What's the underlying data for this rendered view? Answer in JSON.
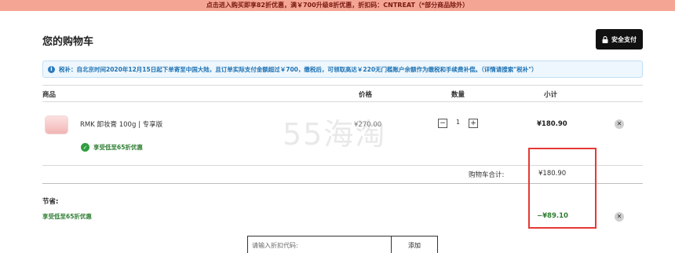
{
  "promo_banner": "点击进入购买即享82折优惠，满￥700升级8折优惠，折扣码：CNTREAT（*部分商品除外）",
  "page_title": "您的购物车",
  "checkout_button": "安全支付",
  "tax_notice": "税补：自北京时间2020年12月15日起下单寄至中国大陆，且订单实际支付金额超过￥700，缴税后，可领取高达￥220无门槛账户余额作为缴税和手续费补偿。（详情请搜索\"税补\"）",
  "table_headers": {
    "product": "商品",
    "price": "价格",
    "quantity": "数量",
    "subtotal": "小计"
  },
  "item": {
    "name": "RMK 卸妆膏 100g | 专享版",
    "unit_price": "¥270.00",
    "quantity": "1",
    "line_total": "¥180.90",
    "discount_note": "享受低至65折优惠"
  },
  "stepper": {
    "minus": "−",
    "plus": "+"
  },
  "cart_total": {
    "label": "购物车合计:",
    "value": "¥180.90"
  },
  "savings": {
    "title": "节省:",
    "label": "享受低至65折优惠",
    "value": "−¥89.10"
  },
  "watermark": "55海淘",
  "coupon": {
    "placeholder": "请输入折扣代码:",
    "button": "添加"
  },
  "colors": {
    "promo_bg": "#f5a594",
    "notice_bg": "#eef7fd",
    "discount_green": "#2e7d32",
    "highlight_red": "#e53935"
  }
}
